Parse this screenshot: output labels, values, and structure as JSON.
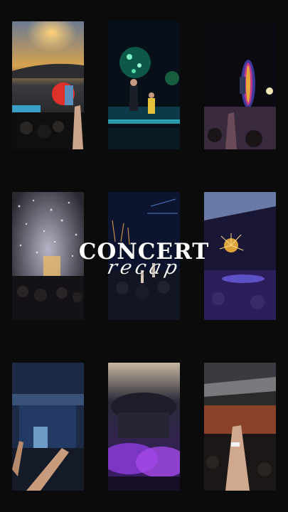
{
  "title": "CONCERT",
  "subtitle": "recap",
  "colors": {
    "background": "#0b0b0c",
    "text": "#ffffff"
  },
  "photos": [
    {
      "scene": "stadium-sunset-stage"
    },
    {
      "scene": "green-lights-performers"
    },
    {
      "scene": "dark-stage-rainbow-screen"
    },
    {
      "scene": "confetti-crowd"
    },
    {
      "scene": "fireworks-dark-crowd"
    },
    {
      "scene": "purple-fireworks-stadium"
    },
    {
      "scene": "blue-stage-raised-hands"
    },
    {
      "scene": "purple-smoke-stage"
    },
    {
      "scene": "daylight-stadium-hands"
    }
  ]
}
